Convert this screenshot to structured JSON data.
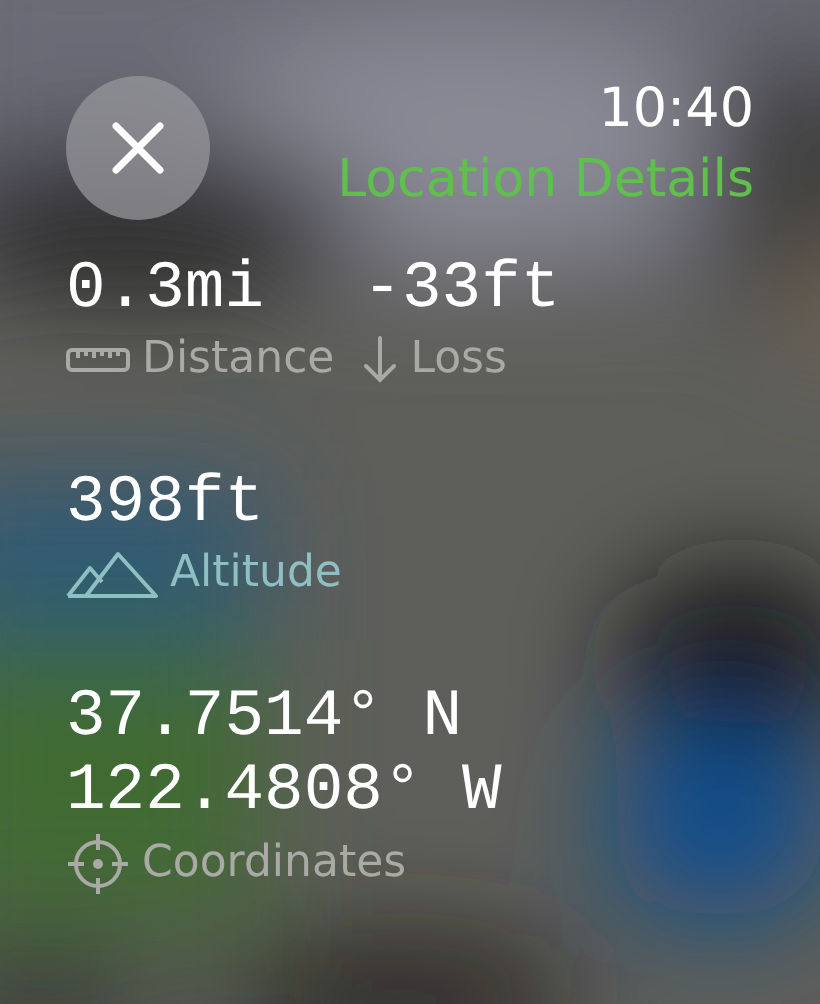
{
  "time": "10:40",
  "title": "Location Details",
  "groups": [
    {
      "cells": [
        {
          "kind": "distance",
          "values": [
            "0.3mi"
          ],
          "label": "Distance",
          "color": "#a9aaa6"
        },
        {
          "kind": "loss",
          "values": [
            "-33ft"
          ],
          "label": "Loss",
          "color": "#a9aaa6"
        }
      ]
    },
    {
      "cells": [
        {
          "kind": "altitude",
          "values": [
            "398ft"
          ],
          "label": "Altitude",
          "color": "#8fbfc2"
        }
      ]
    },
    {
      "cells": [
        {
          "kind": "coordinates",
          "values": [
            "37.7514° N",
            "122.4808° W"
          ],
          "label": "Coordinates",
          "color": "#a9aaa6"
        }
      ]
    }
  ]
}
